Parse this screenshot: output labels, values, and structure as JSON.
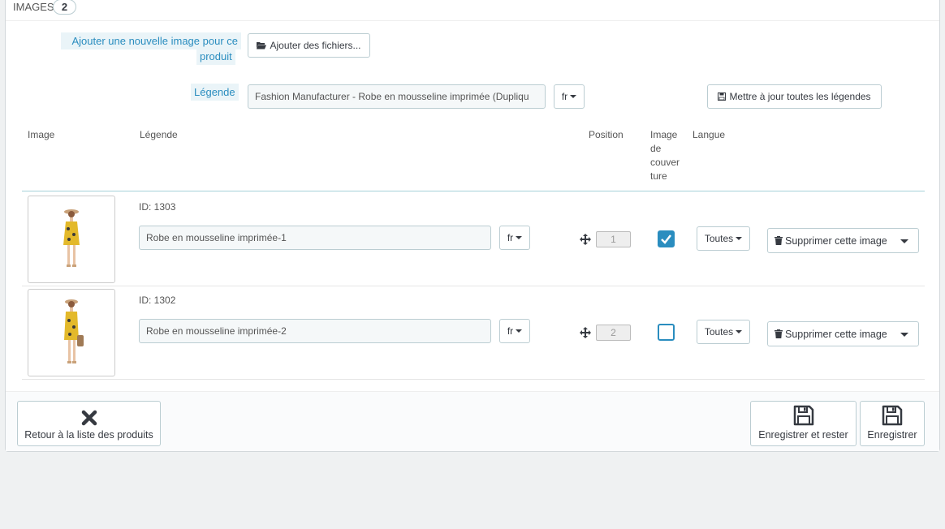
{
  "panel": {
    "title": "Images",
    "count": "2"
  },
  "upload": {
    "label_line1": "Ajouter une nouvelle image pour ce",
    "label_line2": "produit",
    "button": "Ajouter des fichiers..."
  },
  "caption": {
    "label": "Légende",
    "value": "Fashion Manufacturer - Robe en mousseline imprimée (Dupliqu",
    "lang": "fr",
    "update_button": "Mettre à jour toutes les légendes"
  },
  "table": {
    "headers": {
      "image": "Image",
      "legend": "Légende",
      "position": "Position",
      "cover_l1": "Image",
      "cover_l2": "de",
      "cover_l3": "couver",
      "cover_l4": "ture",
      "language": "Langue"
    },
    "rows": [
      {
        "id": "ID: 1303",
        "legend": "Robe en mousseline imprimée-1",
        "lang": "fr",
        "position": "1",
        "cover": true,
        "scope": "Toutes",
        "delete": "Supprimer cette image"
      },
      {
        "id": "ID: 1302",
        "legend": "Robe en mousseline imprimée-2",
        "lang": "fr",
        "position": "2",
        "cover": false,
        "scope": "Toutes",
        "delete": "Supprimer cette image"
      }
    ]
  },
  "footer": {
    "back": "Retour à la liste des produits",
    "save_stay": "Enregistrer et rester",
    "save": "Enregistrer"
  },
  "colors": {
    "accent": "#2a8dbf",
    "border": "#bbcdd2"
  },
  "icons": [
    "folder-open-icon",
    "floppy-icon",
    "move-icon",
    "check-icon",
    "trash-icon",
    "close-icon",
    "save-icon"
  ]
}
